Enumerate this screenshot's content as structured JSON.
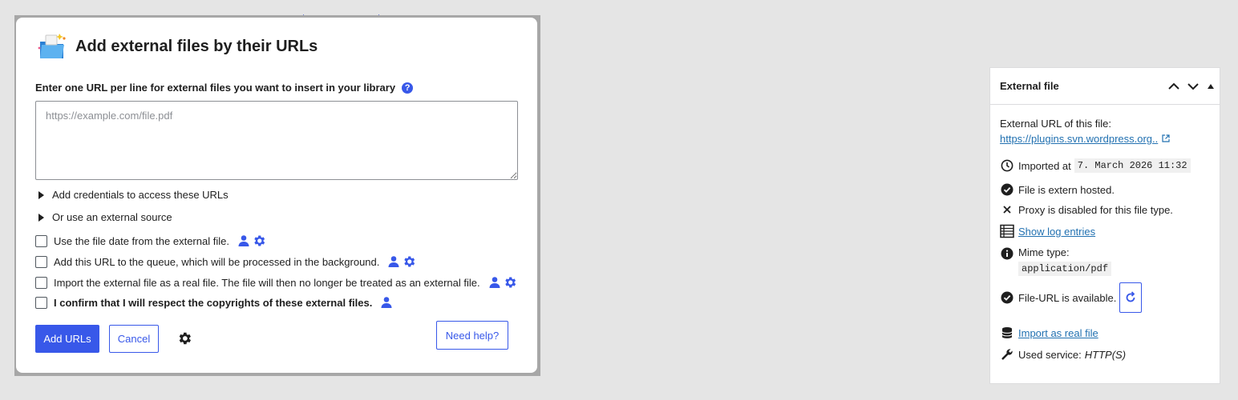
{
  "modal": {
    "title": "Add external files by their URLs",
    "prompt": "Enter one URL per line for external files you want to insert in your library",
    "help_glyph": "?",
    "url_placeholder": "https://example.com/file.pdf",
    "disclosures": [
      {
        "label": "Add credentials to access these URLs"
      },
      {
        "label": "Or use an external source"
      }
    ],
    "options": [
      {
        "label": "Use the file date from the external file.",
        "icons": [
          "user-icon",
          "gear-icon"
        ],
        "bold": false
      },
      {
        "label": "Add this URL to the queue, which will be processed in the background.",
        "icons": [
          "user-icon",
          "gear-icon"
        ],
        "bold": false
      },
      {
        "label": "Import the external file as a real file. The file will then no longer be treated as an external file.",
        "icons": [
          "user-icon",
          "gear-icon"
        ],
        "bold": false
      },
      {
        "label": "I confirm that I will respect the copyrights of these external files.",
        "icons": [
          "user-icon"
        ],
        "bold": true
      }
    ],
    "add_label": "Add URLs",
    "cancel_label": "Cancel",
    "help_label": "Need help?"
  },
  "panel": {
    "title": "External file",
    "url_label": "External URL of this file:",
    "url_link": "https://plugins.svn.wordpress.org..",
    "imported_label": "Imported at",
    "imported_value": "7. March 2026 11:32",
    "extern_hosted": "File is extern hosted.",
    "proxy_status": "Proxy is disabled for this file type.",
    "log_link": "Show log entries",
    "mime_label": "Mime type:",
    "mime_value": "application/pdf",
    "availability": "File-URL is available.",
    "import_link": "Import as real file",
    "service_label": "Used service:",
    "service_value": "HTTP(S)"
  },
  "colors": {
    "accent": "#3858e9",
    "link": "#2271b1",
    "background": "#e5e5e5"
  }
}
